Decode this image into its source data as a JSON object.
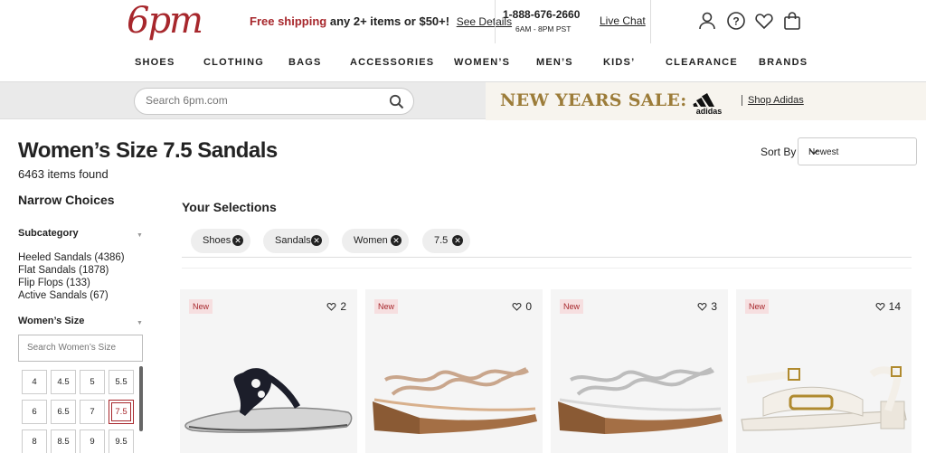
{
  "header": {
    "logo": "6pm",
    "promo_red": "Free shipping",
    "promo_rest": " any 2+ items or $50+!",
    "promo_link": "See Details",
    "phone": "1-888-676-2660",
    "hours": "6AM - 8PM PST",
    "live_chat": "Live Chat",
    "icons": [
      "account-icon",
      "help-icon",
      "heart-icon",
      "bag-icon"
    ]
  },
  "nav": [
    "SHOES",
    "CLOTHING",
    "BAGS",
    "ACCESSORIES",
    "WOMEN’S",
    "MEN’S",
    "KIDS’",
    "CLEARANCE",
    "BRANDS"
  ],
  "search": {
    "placeholder": "Search 6pm.com"
  },
  "banner": {
    "sale_text": "NEW YEARS SALE:",
    "brand": "adidas",
    "link": "Shop Adidas"
  },
  "page": {
    "title": "Women’s Size 7.5 Sandals",
    "count": "6463 items found"
  },
  "sort": {
    "label": "Sort By",
    "value": "Newest"
  },
  "sidebar": {
    "heading": "Narrow Choices",
    "subcategory_label": "Subcategory",
    "subcategories": [
      "Heeled Sandals (4386)",
      "Flat Sandals (1878)",
      "Flip Flops (133)",
      "Active Sandals (67)"
    ],
    "size_label": "Women’s Size",
    "size_search_placeholder": "Search Women’s Size",
    "sizes": [
      "4",
      "4.5",
      "5",
      "5.5",
      "6",
      "6.5",
      "7",
      "7.5",
      "8",
      "8.5",
      "9",
      "9.5"
    ],
    "selected_size": "7.5"
  },
  "selections": {
    "heading": "Your Selections",
    "chips": [
      "Shoes",
      "Sandals",
      "Women",
      "7.5"
    ]
  },
  "products": [
    {
      "badge": "New",
      "favorites": "2"
    },
    {
      "badge": "New",
      "favorites": "0"
    },
    {
      "badge": "New",
      "favorites": "3"
    },
    {
      "badge": "New",
      "favorites": "14"
    }
  ],
  "colors": {
    "brand_red": "#a7272c",
    "sale_gold": "#9c7c39"
  }
}
